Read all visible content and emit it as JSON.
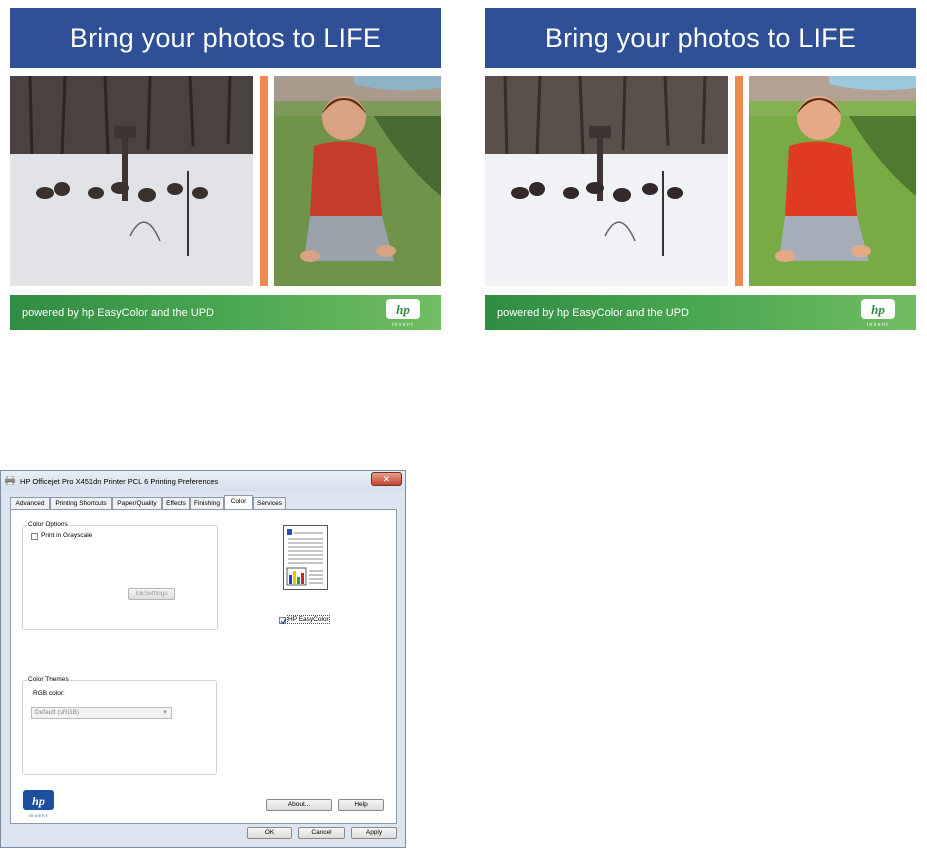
{
  "promo": {
    "title": "Bring your photos to LIFE",
    "footer_text": "powered by hp EasyColor and the UPD",
    "logo_text": "hp",
    "logo_sub": "invent"
  },
  "colors": {
    "banner": "#2f4f96",
    "divider": "#ef8a4e",
    "footer": "#4ea953",
    "dialog_bg": "#dde6f0"
  },
  "dialog": {
    "title": "HP Officejet Pro X451dn Printer PCL 6 Printing Preferences",
    "close_label": "✕",
    "tabs": [
      {
        "label": "Advanced"
      },
      {
        "label": "Printing Shortcuts"
      },
      {
        "label": "Paper/Quality"
      },
      {
        "label": "Effects"
      },
      {
        "label": "Finishing"
      },
      {
        "label": "Color",
        "active": true
      },
      {
        "label": "Services"
      }
    ],
    "color_options": {
      "label": "Color Options",
      "grayscale_label": "Print in Grayscale",
      "grayscale_checked": false,
      "ink_settings_label": "InkSettings"
    },
    "color_themes": {
      "label": "Color Themes",
      "rgb_label": "RGB color:",
      "rgb_value": "Default (sRGB)"
    },
    "easycolor": {
      "label": "HP EasyColor",
      "checked": true
    },
    "buttons": {
      "about": "About...",
      "help": "Help",
      "ok": "OK",
      "cancel": "Cancel",
      "apply": "Apply"
    },
    "logo_text": "hp",
    "logo_sub": "invent"
  }
}
